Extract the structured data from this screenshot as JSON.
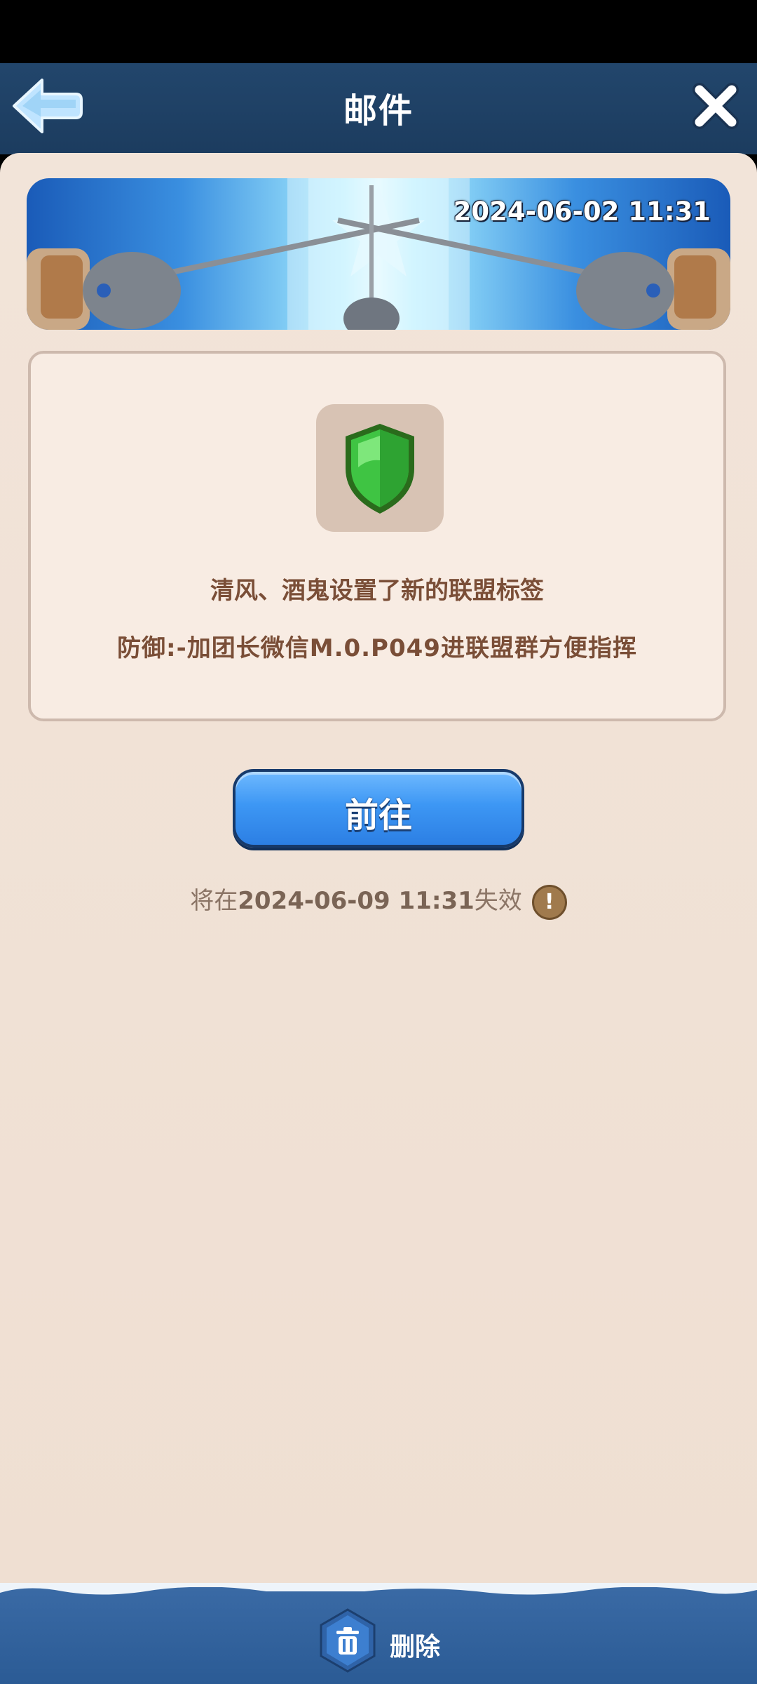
{
  "header": {
    "title": "邮件"
  },
  "banner": {
    "date": "2024-06-02 11:31"
  },
  "message": {
    "title": "清风、酒鬼设置了新的联盟标签",
    "body": "防御:-加团长微信M.0.P049进联盟群方便指挥"
  },
  "action": {
    "goto_label": "前往"
  },
  "expiry": {
    "prefix": "将在",
    "date": "2024-06-09 11:31",
    "suffix": "失效",
    "warn_glyph": "!"
  },
  "footer": {
    "delete_label": "删除"
  },
  "colors": {
    "header": "#22466c",
    "panel": "#f2e4d9",
    "button": "#3d97f4",
    "text_brown": "#7a4e37",
    "shield_green": "#3fc443"
  },
  "icons": {
    "back": "back-arrow-icon",
    "close": "close-icon",
    "shield": "shield-icon",
    "warning": "warning-icon",
    "trash": "trash-icon"
  }
}
